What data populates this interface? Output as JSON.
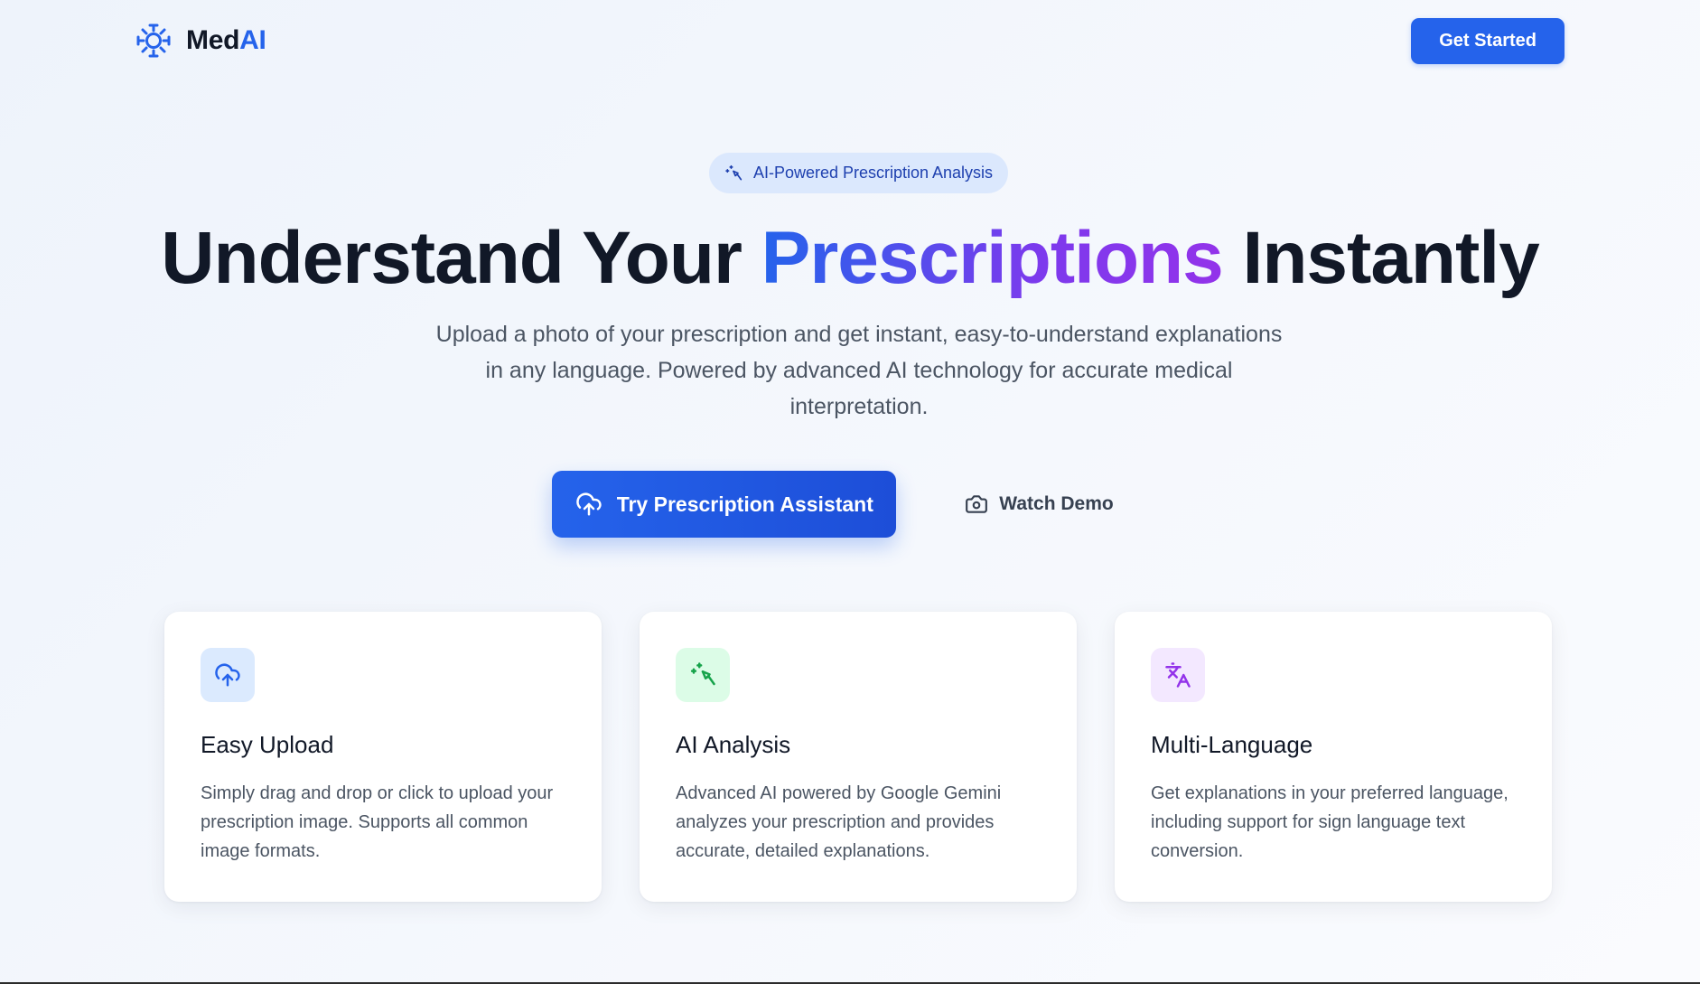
{
  "header": {
    "brand_part1": "Med",
    "brand_part2": "AI",
    "brand_icon": "sun-virus-icon",
    "get_started_label": "Get Started"
  },
  "hero": {
    "badge_icon": "sparkle-wand-icon",
    "badge_label": "AI-Powered Prescription Analysis",
    "title_part1": "Understand Your ",
    "title_highlight": "Prescriptions",
    "title_part2": " Instantly",
    "subtitle": "Upload a photo of your prescription and get instant, easy-to-understand explanations in any language. Powered by advanced AI technology for accurate medical interpretation.",
    "cta_primary_label": "Try Prescription Assistant",
    "cta_primary_icon": "cloud-upload-icon",
    "cta_secondary_label": "Watch Demo",
    "cta_secondary_icon": "camera-icon"
  },
  "features": [
    {
      "icon": "cloud-upload-icon",
      "title": "Easy Upload",
      "description": "Simply drag and drop or click to upload your prescription image. Supports all common image formats."
    },
    {
      "icon": "sparkle-wand-icon",
      "title": "AI Analysis",
      "description": "Advanced AI powered by Google Gemini analyzes your prescription and provides accurate, detailed explanations."
    },
    {
      "icon": "translate-icon",
      "title": "Multi-Language",
      "description": "Get explanations in your preferred language, including support for sign language text conversion."
    }
  ],
  "colors": {
    "brand_blue": "#2563eb",
    "accent_purple": "#9333ea",
    "upload_icon_bg": "#dbeafe",
    "analysis_icon_bg": "#dcfce7",
    "analysis_icon_color": "#16a34a",
    "language_icon_bg": "#f3e8ff",
    "language_icon_color": "#9333ea"
  }
}
